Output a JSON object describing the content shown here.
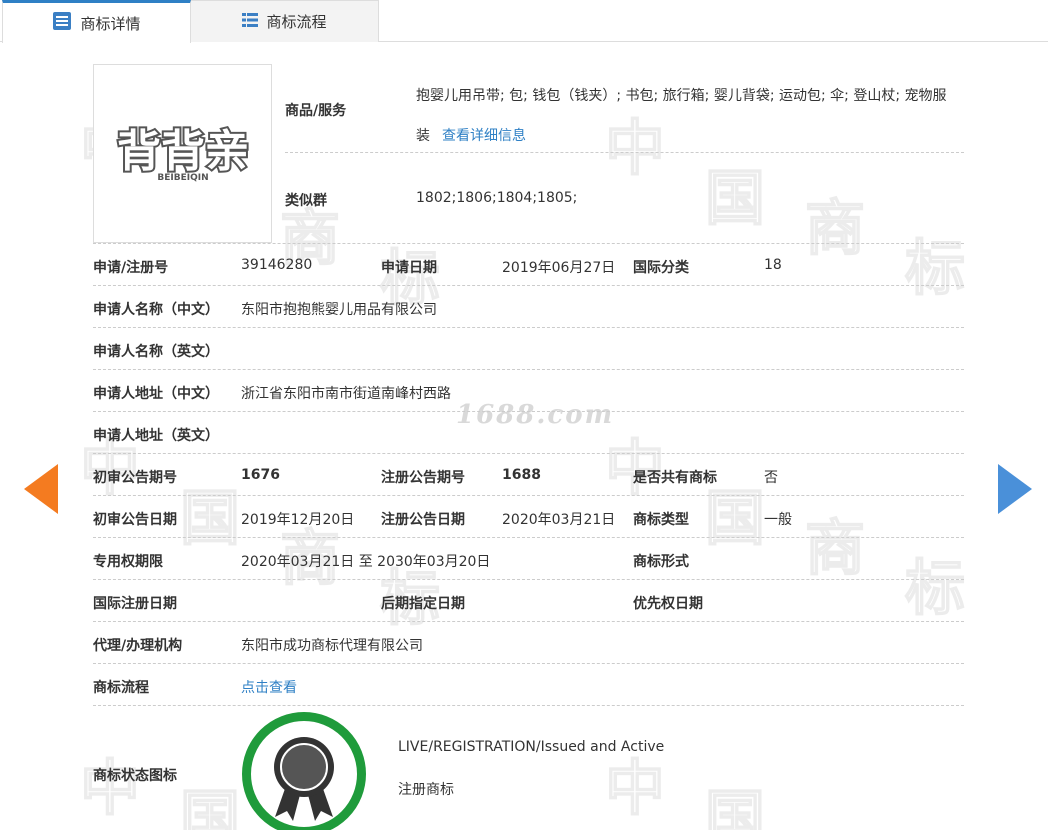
{
  "tabs": [
    {
      "label": "商标详情",
      "icon": "list-doc-icon"
    },
    {
      "label": "商标流程",
      "icon": "list-icon"
    }
  ],
  "logo": {
    "text": "背背亲",
    "sub": "BEIBEIQIN"
  },
  "goods": {
    "label": "商品/服务",
    "value_line1": "抱婴儿用吊带; 包; 钱包（钱夹）; 书包; 旅行箱; 婴儿背袋; 运动包; 伞; 登山杖; 宠物服",
    "value_line2": "装",
    "detail_link": "查看详细信息"
  },
  "similar": {
    "label": "类似群",
    "value": "1802;1806;1804;1805;"
  },
  "rows": {
    "r1": {
      "l1": "申请/注册号",
      "v1": "39146280",
      "l2": "申请日期",
      "v2": "2019年06月27日",
      "l3": "国际分类",
      "v3": "18"
    },
    "r2": {
      "l1": "申请人名称（中文）",
      "v1": "东阳市抱抱熊婴儿用品有限公司"
    },
    "r3": {
      "l1": "申请人名称（英文）",
      "v1": ""
    },
    "r4": {
      "l1": "申请人地址（中文）",
      "v1": "浙江省东阳市南市街道南峰村西路"
    },
    "r5": {
      "l1": "申请人地址（英文）",
      "v1": ""
    },
    "r6": {
      "l1": "初审公告期号",
      "v1": "1676",
      "l2": "注册公告期号",
      "v2": "1688",
      "l3": "是否共有商标",
      "v3": "否"
    },
    "r7": {
      "l1": "初审公告日期",
      "v1": "2019年12月20日",
      "l2": "注册公告日期",
      "v2": "2020年03月21日",
      "l3": "商标类型",
      "v3": "一般"
    },
    "r8": {
      "l1": "专用权期限",
      "v1": "2020年03月21日 至 2030年03月20日",
      "l3": "商标形式",
      "v3": ""
    },
    "r9": {
      "l1": "国际注册日期",
      "v1": "",
      "l2": "后期指定日期",
      "v2": "",
      "l3": "优先权日期",
      "v3": ""
    },
    "r10": {
      "l1": "代理/办理机构",
      "v1": "东阳市成功商标代理有限公司"
    },
    "r11": {
      "l1": "商标流程",
      "v1": "点击查看"
    }
  },
  "status": {
    "label": "商标状态图标",
    "en": "LIVE/REGISTRATION/Issued and Active",
    "cn": "注册商标",
    "color": "#1f9b3b"
  },
  "watermark": {
    "site": "1688.com",
    "chars": [
      "中",
      "国",
      "商",
      "标"
    ]
  },
  "colors": {
    "accent": "#2f80c5",
    "prev_arrow": "#f47b20",
    "next_arrow": "#4a90d9"
  }
}
